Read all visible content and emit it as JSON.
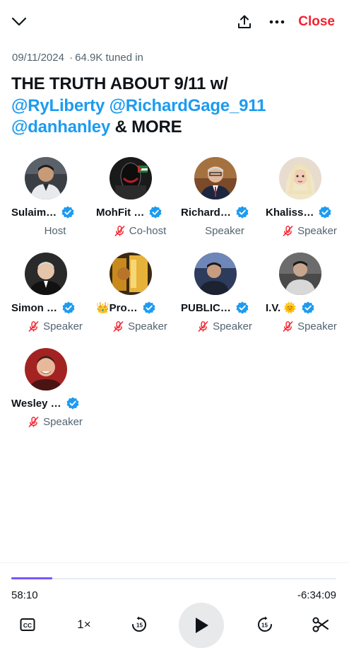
{
  "header": {
    "collapse_icon": "chevron-down-icon",
    "share_icon": "share-icon",
    "more_icon": "more-icon",
    "close_label": "Close"
  },
  "space": {
    "date": "09/11/2024",
    "separator": "·",
    "listeners": "64.9K tuned in",
    "title_line1": "THE TRUTH ABOUT 9/11 w/",
    "mention1": "@RyLiberty",
    "mention2": "@RichardGage_911",
    "mention3": "@danhanley",
    "title_end": "& MORE"
  },
  "participants": [
    {
      "name": "Sulaim…",
      "role": "Host",
      "muted": false
    },
    {
      "name": "MohFit …",
      "role": "Co-host",
      "muted": true
    },
    {
      "name": "Richard…",
      "role": "Speaker",
      "muted": true
    },
    {
      "name": "Khaliss…",
      "role": "Speaker",
      "muted": true
    },
    {
      "name": "Simon …",
      "role": "Speaker",
      "muted": true
    },
    {
      "name": "👑Pro…",
      "role": "Speaker",
      "muted": true
    },
    {
      "name": "PUBLIC…",
      "role": "Speaker",
      "muted": true
    },
    {
      "name": "I.V. 🌞",
      "role": "Speaker",
      "muted": true
    },
    {
      "name": "Wesley …",
      "role": "Speaker",
      "muted": true
    }
  ],
  "player": {
    "elapsed": "58:10",
    "remaining": "-6:34:09",
    "progress": 0.125,
    "speed": "1×",
    "rewind_seconds": "15",
    "forward_seconds": "15"
  },
  "colors": {
    "accent": "#1d9bf0",
    "close": "#f4212e",
    "progress": "#7856ff",
    "secondary_text": "#536471"
  }
}
